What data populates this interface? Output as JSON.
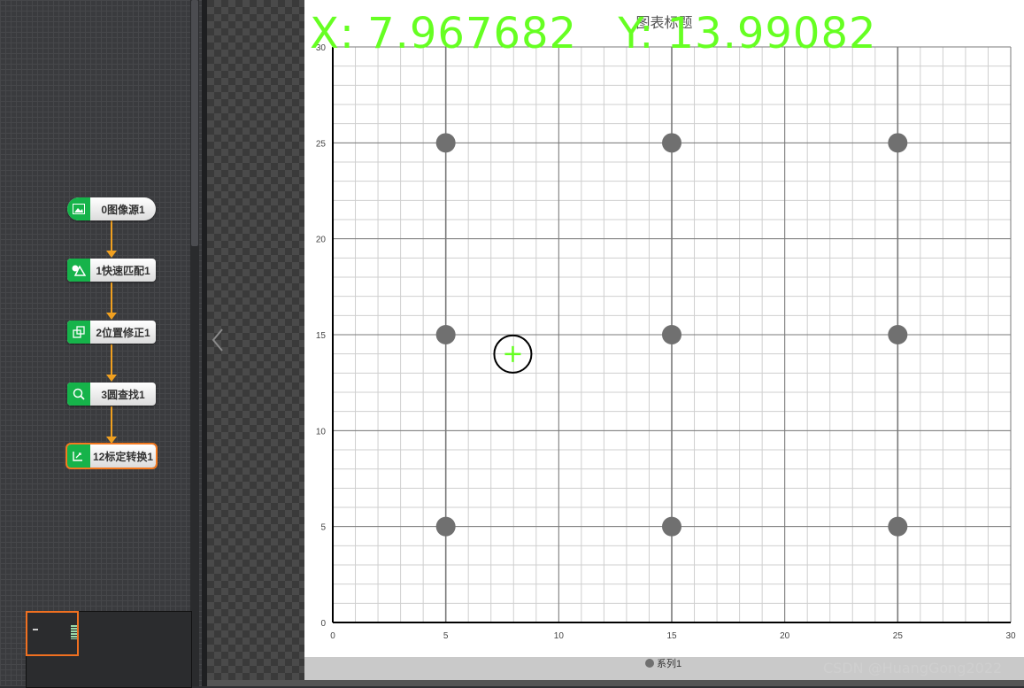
{
  "flow": {
    "nodes": [
      {
        "label": "0图像源1",
        "icon": "image-icon"
      },
      {
        "label": "1快速匹配1",
        "icon": "shapes-match-icon"
      },
      {
        "label": "2位置修正1",
        "icon": "position-fix-icon"
      },
      {
        "label": "3圆查找1",
        "icon": "circle-find-icon"
      },
      {
        "label": "12标定转换1",
        "icon": "calibration-transform-icon"
      }
    ],
    "selected_index": 4
  },
  "readout": {
    "x_label": "X:",
    "x_value": "7.967682",
    "y_label": "Y:",
    "y_value": "13.99082"
  },
  "colors": {
    "node_green": "#16b34a",
    "connector": "#f0a020",
    "readout_green": "#66ff22",
    "point_gray": "#707070",
    "selection_orange": "#f47a20"
  },
  "watermark": "CSDN @HuangGong2022",
  "chart_data": {
    "type": "scatter",
    "title": "图表标题",
    "xlim": [
      0,
      30
    ],
    "ylim": [
      0,
      30
    ],
    "x_ticks": [
      "0",
      "5",
      "10",
      "15",
      "20",
      "25",
      "30"
    ],
    "y_ticks": [
      "0",
      "5",
      "10",
      "15",
      "20",
      "25",
      "30"
    ],
    "grid": true,
    "legend_position": "bottom",
    "series": [
      {
        "name": "系列1",
        "x": [
          5,
          15,
          25,
          5,
          15,
          25,
          5,
          15,
          25
        ],
        "y": [
          25,
          25,
          25,
          15,
          15,
          15,
          5,
          5,
          5
        ]
      }
    ],
    "marker": {
      "x": 7.967682,
      "y": 13.99082
    }
  }
}
